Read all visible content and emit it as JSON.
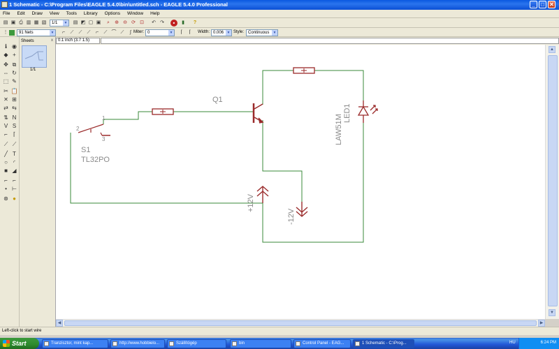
{
  "window": {
    "title": "1 Schematic - C:\\Program Files\\EAGLE 5.4.0\\bin\\untitled.sch - EAGLE 5.4.0 Professional",
    "min": "_",
    "max": "□",
    "close": "✕"
  },
  "menu": [
    "File",
    "Edit",
    "Draw",
    "View",
    "Tools",
    "Library",
    "Options",
    "Window",
    "Help"
  ],
  "toolbar": {
    "sheet_select": "1/1",
    "nets_select": "91 Nets",
    "miter_label": "Miter:",
    "miter_value": "0",
    "width_label": "Width:",
    "width_value": "0.006",
    "style_label": "Style:",
    "style_value": "Continuous"
  },
  "command": {
    "coordinate": "0.1 inch (3.7 1.5)",
    "input": ""
  },
  "sheets": {
    "header": "Sheets",
    "close": "x",
    "thumb_label": "1/1"
  },
  "schematic": {
    "labels": {
      "q1": "Q1",
      "s1": "S1",
      "s1_value": "TL32PO",
      "pin1": "1",
      "pin2": "2",
      "pin3": "3",
      "led_name": "LED1",
      "led_value": "LAW51M",
      "vplus": "+12V",
      "vminus": "-12V"
    },
    "colors": {
      "wire": "#3a8a3a",
      "symbol": "#9a2a2a",
      "text": "#8a8a8a"
    }
  },
  "status": {
    "text": "Left-click to start wire"
  },
  "taskbar": {
    "start": "Start",
    "tasks": [
      "Tranzisztor, mint kap...",
      "http://www.hobbielo...",
      "Szállítógép",
      "bin",
      "Control Panel - EAG...",
      "1 Schematic - C:\\Prog..."
    ],
    "lang": "HU",
    "clock": "6:24 PM"
  }
}
